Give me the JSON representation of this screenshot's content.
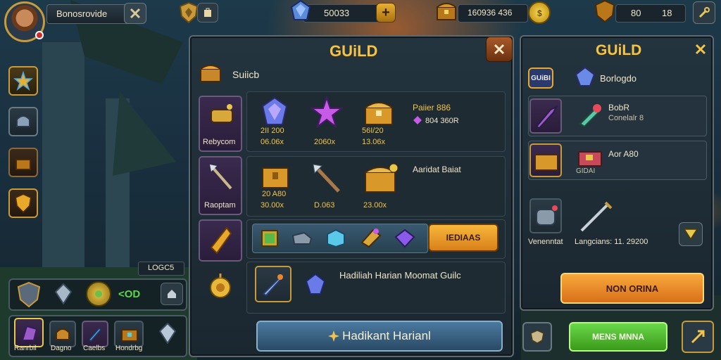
{
  "top_bar": {
    "player_name": "Bonosrovide",
    "gem_value": "50033",
    "chest_value": "160936 436",
    "stat_a": "80",
    "stat_b": "18"
  },
  "left_bar": {
    "stat_label": "LOGC5",
    "count_label": "<OD"
  },
  "bottom_slots": [
    "Ranrbil",
    "Dagno",
    "Caelbs",
    "Hondrbg"
  ],
  "guild_main": {
    "title": "GUiLD",
    "subtitle": "Suiicb",
    "row1": {
      "tab_label": "Rebycom",
      "item1": {
        "top": "2II 200",
        "bottom": "06.06x"
      },
      "item2": {
        "bottom": "2060x"
      },
      "item3": {
        "top": "56I/20",
        "bottom": "13.06x"
      },
      "info_title": "Paiier 886",
      "info_sub": "804 360R"
    },
    "row2": {
      "tab_label": "Raoptam",
      "item1": {
        "top": "20 A80",
        "bottom": "30.00x"
      },
      "item2": {
        "bottom": "D.063"
      },
      "item3": {
        "bottom": "23.00x"
      },
      "info_title": "Aaridat Baiat"
    },
    "strip_button": "IEDIAAS",
    "detail_text": "Hadiliah Harian Moomat Guilc",
    "bottom_button": "Hadikant Harianl"
  },
  "guild_side": {
    "title": "GUiLD",
    "badge": "GUiBI",
    "header_label": "Borlogdo",
    "card1": {
      "title": "BobR",
      "sub": "Conelalr 8"
    },
    "card2": {
      "title": "Aor A80",
      "sub": "GIDAI"
    },
    "footer_left": "Venenntat",
    "footer_right": "Langcians: 11. 29200",
    "action_button": "NON ORINA",
    "green_button": "MENS MNNA"
  },
  "colors": {
    "gold": "#f2c44a",
    "orange": "#f39a1a",
    "green": "#4cb02a",
    "purple": "#5a3a7a"
  }
}
